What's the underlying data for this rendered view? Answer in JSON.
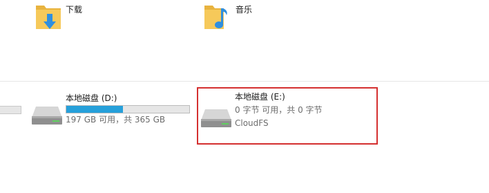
{
  "folders": [
    {
      "label": "下载",
      "icon": "downloads-folder-icon"
    },
    {
      "label": "音乐",
      "icon": "music-folder-icon"
    }
  ],
  "drives": {
    "d": {
      "name": "本地磁盘 (D:)",
      "space": "197 GB 可用，共 365 GB",
      "used_fraction": 0.46,
      "icon": "hard-drive-icon"
    },
    "e": {
      "name": "本地磁盘 (E:)",
      "space": "0 字节 可用，共 0 字节",
      "filesystem": "CloudFS",
      "icon": "hard-drive-icon"
    }
  },
  "colors": {
    "capacity_fill": "#26a0da",
    "highlight_border": "#d42f2f",
    "folder_yellow": "#f4c04c",
    "download_arrow": "#2f8fe0",
    "music_note": "#2f8fe0"
  }
}
